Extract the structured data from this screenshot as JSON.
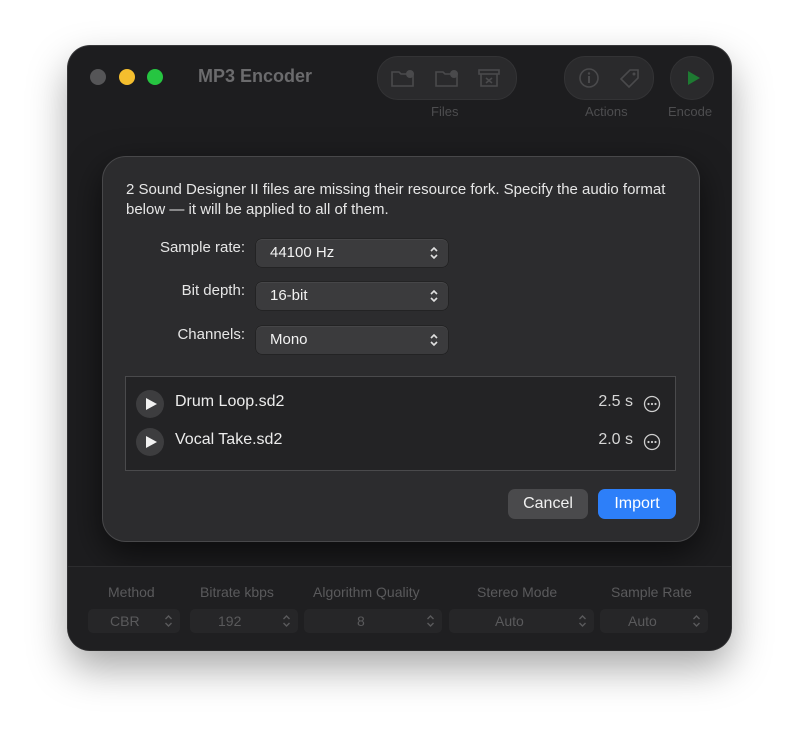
{
  "window": {
    "title": "MP3 Encoder"
  },
  "toolbar": {
    "files_label": "Files",
    "actions_label": "Actions",
    "encode_label": "Encode"
  },
  "dialog": {
    "message": "2 Sound Designer II files are missing their resource fork.  Specify the audio format below — it will be applied to all of them.",
    "sample_rate": {
      "label": "Sample rate:",
      "value": "44100 Hz"
    },
    "bit_depth": {
      "label": "Bit depth:",
      "value": "16-bit"
    },
    "channels": {
      "label": "Channels:",
      "value": "Mono"
    },
    "files": [
      {
        "name": "Drum Loop.sd2",
        "duration": "2.5 s"
      },
      {
        "name": "Vocal Take.sd2",
        "duration": "2.0 s"
      }
    ],
    "cancel_label": "Cancel",
    "import_label": "Import"
  },
  "settings": {
    "method": {
      "label": "Method",
      "value": "CBR"
    },
    "bitrate": {
      "label": "Bitrate kbps",
      "value": "192"
    },
    "quality": {
      "label": "Algorithm Quality",
      "value": "8"
    },
    "stereo": {
      "label": "Stereo Mode",
      "value": "Auto"
    },
    "sample_rate": {
      "label": "Sample Rate",
      "value": "Auto"
    }
  },
  "colors": {
    "accent": "#2d7ff9",
    "encode_play": "#1e9e3a"
  }
}
